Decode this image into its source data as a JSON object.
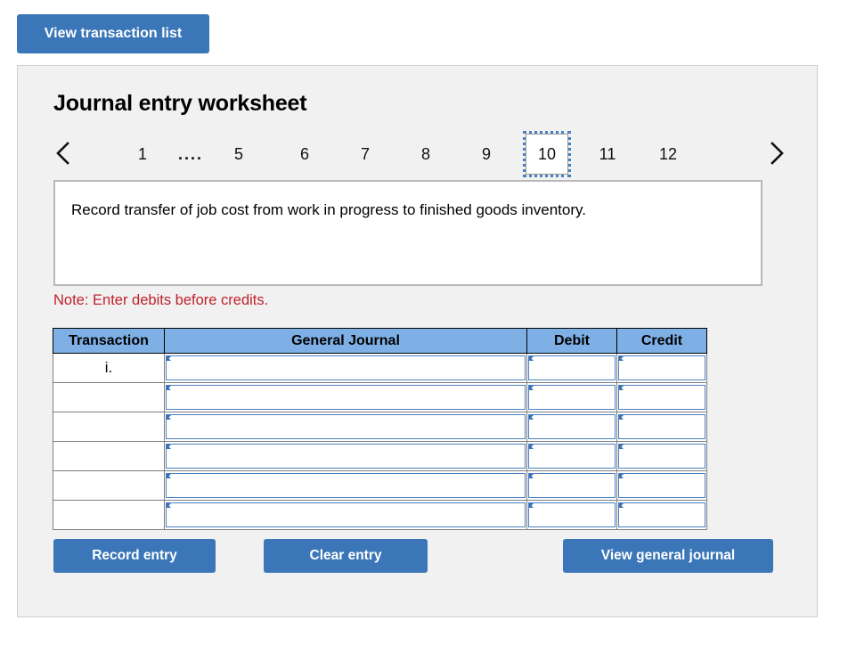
{
  "top": {
    "view_transaction_list_label": "View transaction list"
  },
  "worksheet": {
    "title": "Journal entry worksheet",
    "description": "Record transfer of job cost from work in progress to finished goods inventory.",
    "note": "Note: Enter debits before credits."
  },
  "pager": {
    "prev_icon": "chevron-left-icon",
    "next_icon": "chevron-right-icon",
    "tabs": [
      {
        "label": "1",
        "selected": false
      },
      {
        "label": "....",
        "selected": false
      },
      {
        "label": "5",
        "selected": false
      },
      {
        "label": "6",
        "selected": false
      },
      {
        "label": "7",
        "selected": false
      },
      {
        "label": "8",
        "selected": false
      },
      {
        "label": "9",
        "selected": false
      },
      {
        "label": "10",
        "selected": true
      },
      {
        "label": "11",
        "selected": false
      },
      {
        "label": "12",
        "selected": false
      }
    ],
    "selected_tab": "10"
  },
  "table": {
    "headers": [
      "Transaction",
      "General Journal",
      "Debit",
      "Credit"
    ],
    "rows": [
      {
        "transaction": "i.",
        "general_journal": "",
        "debit": "",
        "credit": ""
      },
      {
        "transaction": "",
        "general_journal": "",
        "debit": "",
        "credit": ""
      },
      {
        "transaction": "",
        "general_journal": "",
        "debit": "",
        "credit": ""
      },
      {
        "transaction": "",
        "general_journal": "",
        "debit": "",
        "credit": ""
      },
      {
        "transaction": "",
        "general_journal": "",
        "debit": "",
        "credit": ""
      },
      {
        "transaction": "",
        "general_journal": "",
        "debit": "",
        "credit": ""
      }
    ]
  },
  "actions": {
    "record_entry_label": "Record entry",
    "clear_entry_label": "Clear entry",
    "view_general_journal_label": "View general journal"
  },
  "colors": {
    "button_blue": "#3b77b8",
    "header_blue": "#7eb0e5",
    "panel_gray": "#f1f1f1",
    "note_red": "#c0212b",
    "cell_border_blue": "#4a80c0"
  }
}
